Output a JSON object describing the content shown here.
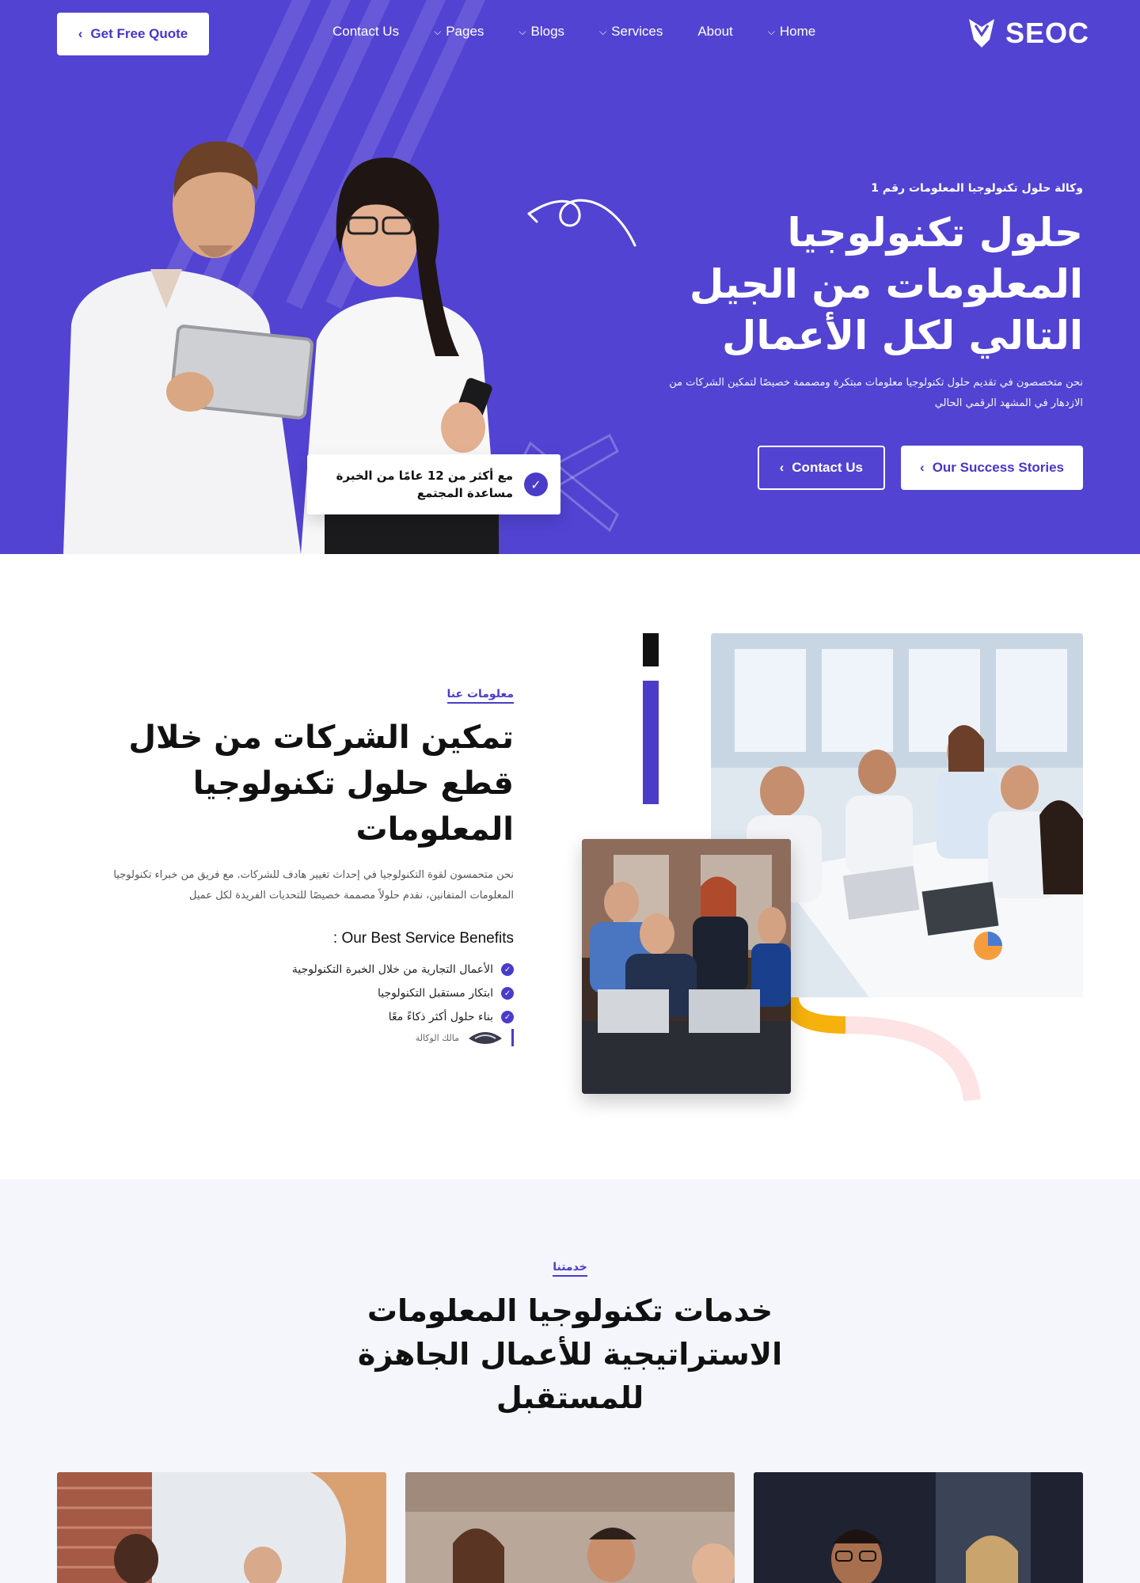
{
  "header": {
    "quote_button": "Get Free Quote",
    "nav": [
      {
        "label": "Contact Us",
        "dropdown": false
      },
      {
        "label": "Pages",
        "dropdown": true
      },
      {
        "label": "Blogs",
        "dropdown": true
      },
      {
        "label": "Services",
        "dropdown": true
      },
      {
        "label": "About",
        "dropdown": false
      },
      {
        "label": "Home",
        "dropdown": true
      }
    ],
    "logo_text": "SEOC"
  },
  "hero": {
    "eyebrow": "وكالة حلول تكنولوجيا المعلومات رقم 1",
    "title": "حلول تكنولوجيا المعلومات من الجيل التالي لكل الأعمال",
    "description": "نحن متخصصون في تقديم حلول تكنولوجيا معلومات مبتكرة ومصممة خصيصًا لتمكين الشركات من الازدهار في المشهد الرقمي الحالي",
    "contact_button": "Contact Us",
    "stories_button": "Our Success Stories",
    "badge_text": "مع أكثر من 12 عامًا من الخبرة مساعدة المجتمع"
  },
  "about": {
    "label": "معلومات عنا",
    "title": "تمكين الشركات من خلال قطع حلول تكنولوجيا المعلومات",
    "description": "نحن متحمسون لقوة التكنولوجيا في إحداث تغيير هادف للشركات. مع فريق من خبراء تكنولوجيا المعلومات المتفانين، نقدم حلولاً مصممة خصيصًا للتحديات الفريدة لكل عميل",
    "benefits_title": ": Our Best Service Benefits",
    "benefits": [
      "الأعمال التجارية من خلال الخبرة التكنولوجية",
      "ابتكار مستقبل التكنولوجيا",
      "بناء حلول أكثر ذكاءً معًا"
    ],
    "signature_text": "مالك الوكالة"
  },
  "services": {
    "label": "خدمتنا",
    "title": "خدمات تكنولوجيا المعلومات الاستراتيجية للأعمال الجاهزة للمستقبل"
  },
  "colors": {
    "brand_purple": "#5243d2",
    "accent_yellow": "#f6b10c",
    "accent_pink": "#fde3e3"
  },
  "icons": [
    "chevron-left-icon",
    "chevron-down-icon",
    "check-circle-icon",
    "logo-icon"
  ]
}
